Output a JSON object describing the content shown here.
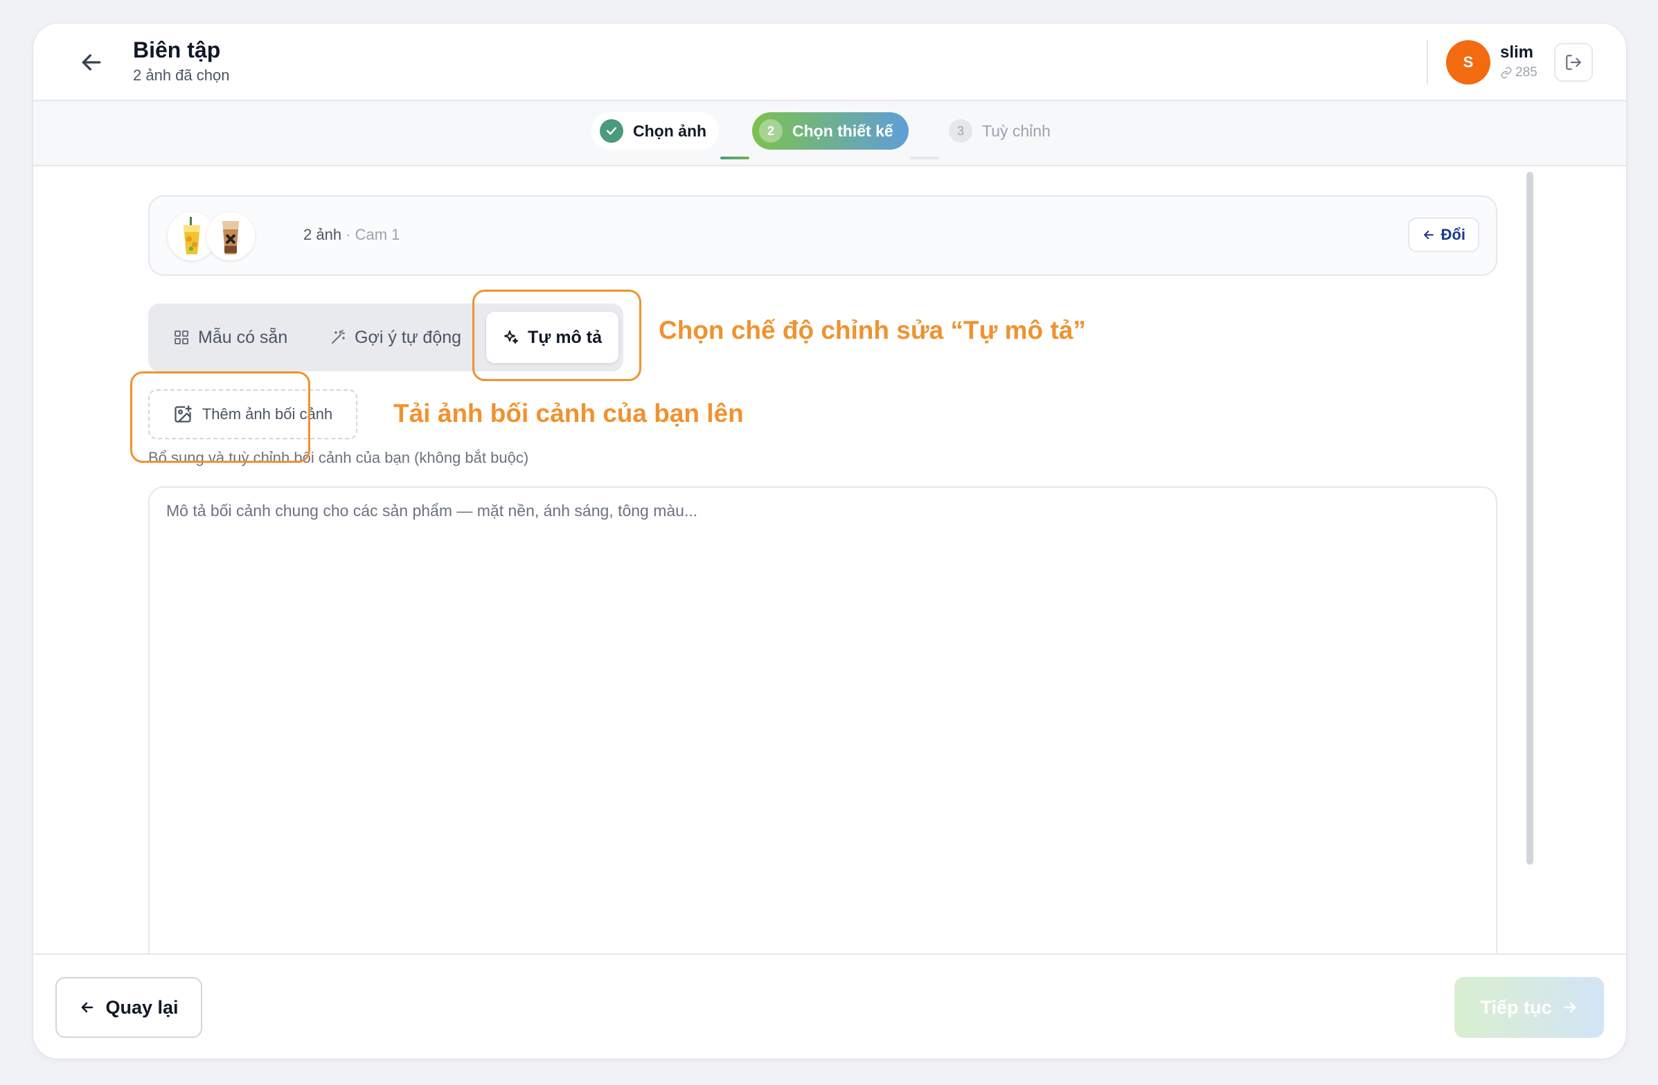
{
  "header": {
    "title": "Biên tập",
    "subtitle": "2 ảnh đã chọn",
    "user": {
      "initial": "S",
      "name": "slim",
      "credits": "285"
    }
  },
  "stepper": {
    "steps": [
      {
        "number": "",
        "label": "Chọn ảnh",
        "state": "done"
      },
      {
        "number": "2",
        "label": "Chọn thiết kế",
        "state": "active"
      },
      {
        "number": "3",
        "label": "Tuỳ chỉnh",
        "state": "pending"
      }
    ]
  },
  "images_bar": {
    "count": "2 ảnh",
    "separator": " · ",
    "source": "Cam 1",
    "change_label": "Đổi"
  },
  "mode_tabs": [
    {
      "label": "Mẫu có sẵn",
      "icon": "grid-icon",
      "active": false
    },
    {
      "label": "Gợi ý tự động",
      "icon": "magic-wand-icon",
      "active": false
    },
    {
      "label": "Tự mô tả",
      "icon": "sparkles-icon",
      "active": true
    }
  ],
  "context": {
    "add_button_label": "Thêm ảnh bối cảnh",
    "hint": "Bổ sung và tuỳ chỉnh bối cảnh của bạn (không bắt buộc)",
    "description_placeholder": "Mô tả bối cảnh chung cho các sản phẩm — mặt nền, ánh sáng, tông màu...",
    "description_value": ""
  },
  "annotations": {
    "mode": "Chọn chế độ chỉnh sửa “Tự mô tả”",
    "upload": "Tải ảnh bối cảnh của bạn lên"
  },
  "footer": {
    "back_label": "Quay lại",
    "next_label": "Tiếp tục"
  },
  "colors": {
    "accent_orange": "#f26b10",
    "annotation": "#f0922f",
    "step_done": "#4a9a7c",
    "step_active_start": "#7cc14e",
    "step_active_end": "#5f9ed8"
  }
}
